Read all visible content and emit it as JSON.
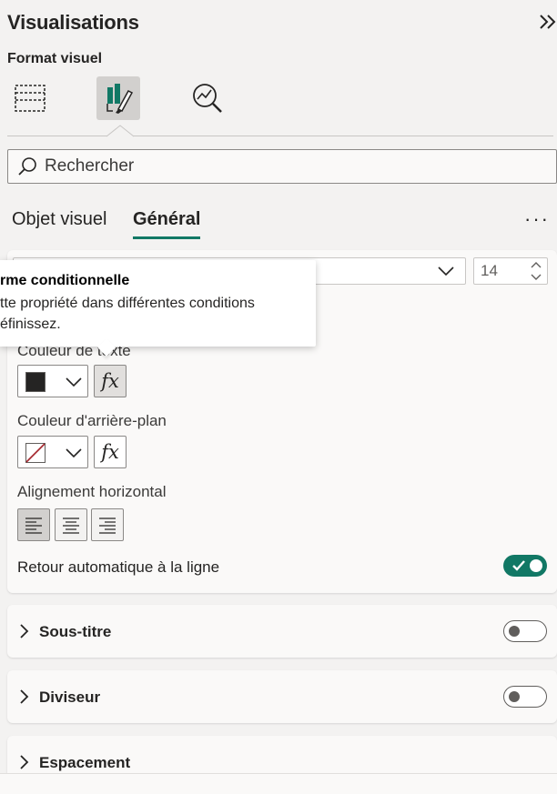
{
  "header": {
    "title": "Visualisations",
    "subtitle": "Format visuel",
    "collapse_icon": "chevron-double-right-icon"
  },
  "visual_tabs": [
    {
      "name": "build-visual-icon",
      "active": false
    },
    {
      "name": "format-visual-icon",
      "active": true
    },
    {
      "name": "analytics-icon",
      "active": false
    }
  ],
  "search": {
    "placeholder": "Rechercher",
    "icon": "search-icon"
  },
  "subtabs": {
    "objet_visuel": "Objet visuel",
    "general": "Général",
    "active": "general",
    "more": "···"
  },
  "font": {
    "size": "14"
  },
  "tooltip": {
    "title": "rme conditionnelle",
    "line1": "tte propriété dans différentes conditions",
    "line2": "éfinissez."
  },
  "text_color": {
    "label": "Couleur de texte",
    "swatch": "#252423",
    "fx": "fx"
  },
  "background_color": {
    "label": "Couleur d'arrière-plan",
    "swatch": "none",
    "fx": "fx"
  },
  "alignment": {
    "label": "Alignement horizontal",
    "options": [
      "left",
      "center",
      "right"
    ],
    "active": "left"
  },
  "word_wrap": {
    "label": "Retour automatique à la ligne",
    "on": true
  },
  "sections": [
    {
      "label": "Sous-titre",
      "on": false
    },
    {
      "label": "Diviseur",
      "on": false
    },
    {
      "label": "Espacement"
    }
  ],
  "colors": {
    "accent": "#117865",
    "background": "#f3f2f1",
    "card": "#faf9f8"
  }
}
